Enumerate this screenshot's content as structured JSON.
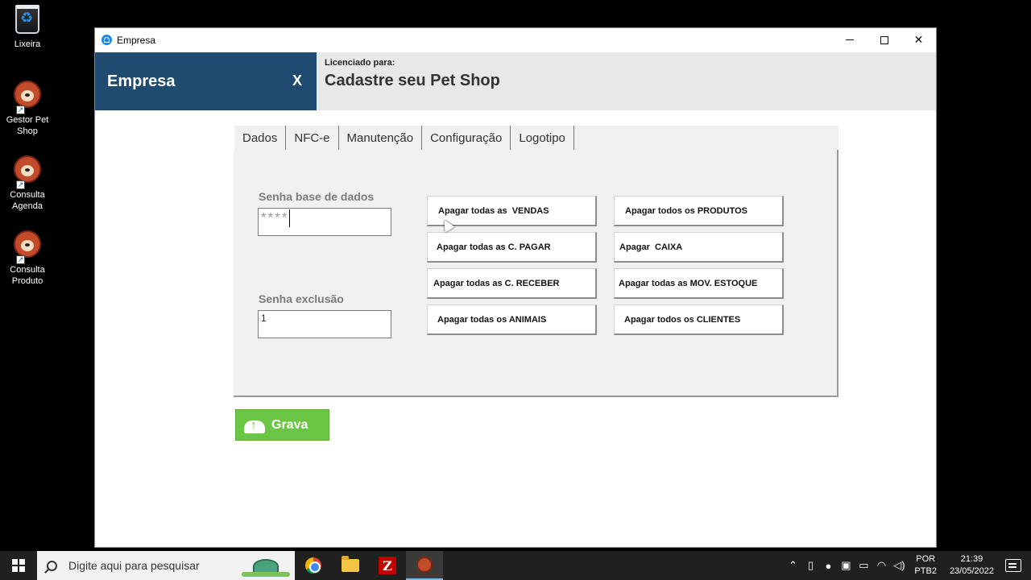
{
  "desktop": {
    "icons": [
      {
        "label": "Lixeira",
        "icon": "recycle-bin-icon"
      },
      {
        "label": "Gestor Pet\nShop",
        "icon": "pet-dog-icon"
      },
      {
        "label": "Consulta\nAgenda",
        "icon": "pet-dog-icon"
      },
      {
        "label": "Consulta\nProduto",
        "icon": "pet-dog-icon"
      }
    ]
  },
  "window": {
    "title": "Empresa",
    "header": {
      "title": "Empresa",
      "close_label": "X",
      "licensed_label": "Licenciado para:",
      "licensed_name": "Cadastre seu Pet Shop"
    },
    "tabs": [
      {
        "label": "Dados"
      },
      {
        "label": "NFC-e"
      },
      {
        "label": "Manutenção",
        "active": true
      },
      {
        "label": "Configuração"
      },
      {
        "label": "Logotipo"
      }
    ],
    "maintenance": {
      "db_password_label": "Senha base de dados",
      "db_password_value": "****",
      "delete_password_label": "Senha exclusão",
      "delete_password_value": "1",
      "buttons_left": [
        "Apagar todas as  VENDAS",
        "Apagar todas as C. PAGAR",
        "Apagar todas as C. RECEBER",
        "Apagar todas os ANIMAIS"
      ],
      "buttons_right": [
        "Apagar todos os PRODUTOS",
        "Apagar  CAIXA",
        "Apagar todas as MOV. ESTOQUE",
        "Apagar todos os CLIENTES"
      ]
    },
    "save_label": "Grava"
  },
  "taskbar": {
    "search_placeholder": "Digite aqui para pesquisar",
    "lang_top": "POR",
    "lang_bottom": "PTB2",
    "time": "21:39",
    "date": "23/05/2022"
  },
  "colors": {
    "header_blue": "#1f4b71",
    "save_green": "#6cc645"
  }
}
